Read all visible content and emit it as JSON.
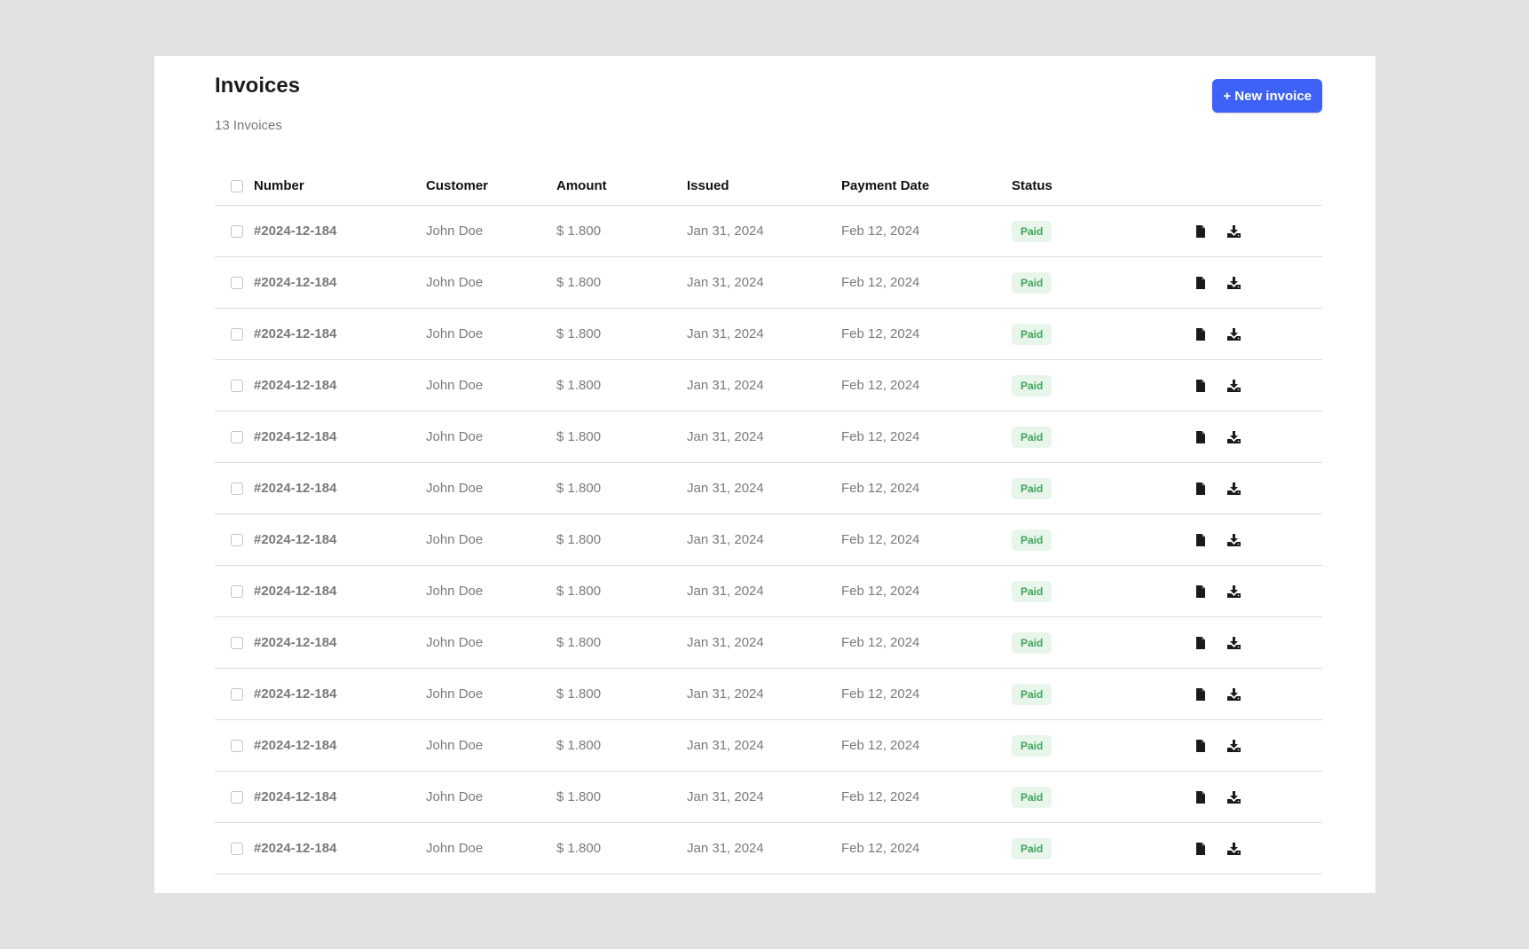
{
  "page": {
    "title": "Invoices",
    "subtitle": "13 Invoices",
    "new_button": "+ New invoice"
  },
  "colors": {
    "accent": "#3f62f6",
    "paid_bg": "#e7f5ea",
    "paid_text": "#3ea558"
  },
  "table": {
    "headers": {
      "number": "Number",
      "customer": "Customer",
      "amount": "Amount",
      "issued": "Issued",
      "payment_date": "Payment Date",
      "status": "Status"
    },
    "row_icons": [
      "file-icon",
      "download-icon"
    ],
    "rows": [
      {
        "number": "#2024-12-184",
        "customer": "John Doe",
        "amount": "$ 1.800",
        "issued": "Jan 31, 2024",
        "payment_date": "Feb 12, 2024",
        "status": "Paid"
      },
      {
        "number": "#2024-12-184",
        "customer": "John Doe",
        "amount": "$ 1.800",
        "issued": "Jan 31, 2024",
        "payment_date": "Feb 12, 2024",
        "status": "Paid"
      },
      {
        "number": "#2024-12-184",
        "customer": "John Doe",
        "amount": "$ 1.800",
        "issued": "Jan 31, 2024",
        "payment_date": "Feb 12, 2024",
        "status": "Paid"
      },
      {
        "number": "#2024-12-184",
        "customer": "John Doe",
        "amount": "$ 1.800",
        "issued": "Jan 31, 2024",
        "payment_date": "Feb 12, 2024",
        "status": "Paid"
      },
      {
        "number": "#2024-12-184",
        "customer": "John Doe",
        "amount": "$ 1.800",
        "issued": "Jan 31, 2024",
        "payment_date": "Feb 12, 2024",
        "status": "Paid"
      },
      {
        "number": "#2024-12-184",
        "customer": "John Doe",
        "amount": "$ 1.800",
        "issued": "Jan 31, 2024",
        "payment_date": "Feb 12, 2024",
        "status": "Paid"
      },
      {
        "number": "#2024-12-184",
        "customer": "John Doe",
        "amount": "$ 1.800",
        "issued": "Jan 31, 2024",
        "payment_date": "Feb 12, 2024",
        "status": "Paid"
      },
      {
        "number": "#2024-12-184",
        "customer": "John Doe",
        "amount": "$ 1.800",
        "issued": "Jan 31, 2024",
        "payment_date": "Feb 12, 2024",
        "status": "Paid"
      },
      {
        "number": "#2024-12-184",
        "customer": "John Doe",
        "amount": "$ 1.800",
        "issued": "Jan 31, 2024",
        "payment_date": "Feb 12, 2024",
        "status": "Paid"
      },
      {
        "number": "#2024-12-184",
        "customer": "John Doe",
        "amount": "$ 1.800",
        "issued": "Jan 31, 2024",
        "payment_date": "Feb 12, 2024",
        "status": "Paid"
      },
      {
        "number": "#2024-12-184",
        "customer": "John Doe",
        "amount": "$ 1.800",
        "issued": "Jan 31, 2024",
        "payment_date": "Feb 12, 2024",
        "status": "Paid"
      },
      {
        "number": "#2024-12-184",
        "customer": "John Doe",
        "amount": "$ 1.800",
        "issued": "Jan 31, 2024",
        "payment_date": "Feb 12, 2024",
        "status": "Paid"
      },
      {
        "number": "#2024-12-184",
        "customer": "John Doe",
        "amount": "$ 1.800",
        "issued": "Jan 31, 2024",
        "payment_date": "Feb 12, 2024",
        "status": "Paid"
      }
    ]
  }
}
